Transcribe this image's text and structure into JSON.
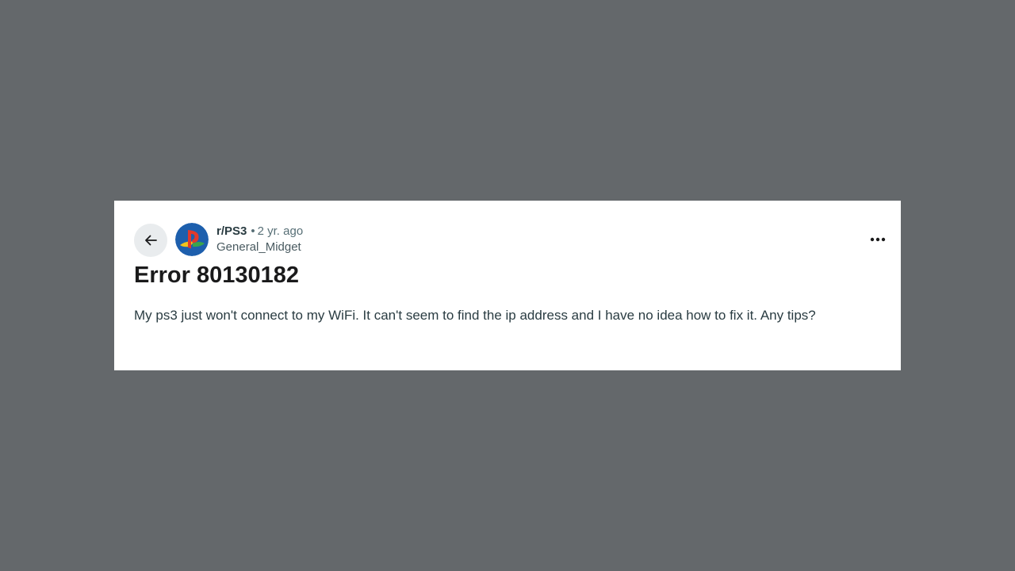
{
  "post": {
    "subreddit": "r/PS3",
    "separator": "•",
    "age": "2 yr. ago",
    "author": "General_Midget",
    "title": "Error 80130182",
    "body": "My ps3 just won't connect to my WiFi. It can't seem to find the ip address and I have no idea how to fix it. Any tips?"
  },
  "icons": {
    "back": "arrow-left-icon",
    "avatar": "playstation-logo-icon",
    "more": "more-horizontal-icon"
  },
  "colors": {
    "backdrop": "#64686b",
    "card": "#ffffff",
    "title": "#1a1a1b",
    "text": "#2a3c42",
    "muted": "#576f76"
  }
}
